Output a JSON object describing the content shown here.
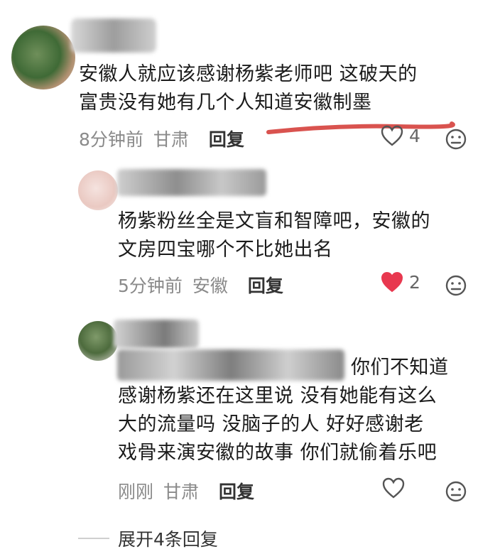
{
  "comments": [
    {
      "text_line1": "安徽人就应该感谢杨紫老师吧 这破天的",
      "text_line2": "富贵没有她有几个人知道安徽制墨",
      "time": "8分钟前",
      "location": "甘肃",
      "reply_label": "回复",
      "like_count": "4",
      "liked": false
    },
    {
      "text_line1": "杨紫粉丝全是文盲和智障吧，安徽的",
      "text_line2": "文房四宝哪个不比她出名",
      "time": "5分钟前",
      "location": "安徽",
      "reply_label": "回复",
      "like_count": "2",
      "liked": true
    },
    {
      "text_line1": "你们不知道",
      "text_line2": "感谢杨紫还在这里说 没有她能有这么",
      "text_line3": "大的流量吗 没脑子的人 好好感谢老",
      "text_line4": "戏骨来演安徽的故事 你们就偷着乐吧",
      "time": "刚刚",
      "location": "甘肃",
      "reply_label": "回复",
      "like_count": "",
      "liked": false
    }
  ],
  "expand_label": "展开4条回复",
  "colors": {
    "underline": "#d9534f",
    "liked_heart": "#e8384f",
    "muted_text": "#8a8a8a"
  },
  "icons": {
    "like": "heart-icon",
    "liked": "heart-filled-icon",
    "emoji": "neutral-face-icon"
  }
}
